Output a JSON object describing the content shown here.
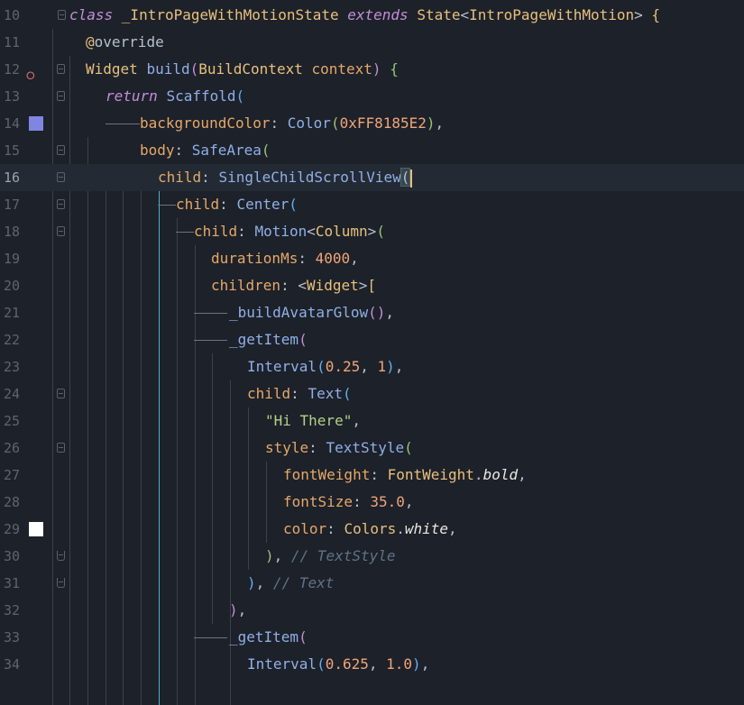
{
  "editor": {
    "language": "dart",
    "current_line": 16,
    "colors": {
      "background": "#1d2129",
      "swatch_line_14": "#8185E2",
      "swatch_line_29": "#FFFFFF"
    },
    "lines": [
      {
        "n": "10",
        "segs": [
          [
            "kw",
            "class "
          ],
          [
            "cls",
            "_IntroPageWithMotionState "
          ],
          [
            "kw",
            "extends "
          ],
          [
            "cls",
            "State"
          ],
          [
            "pun",
            "<"
          ],
          [
            "cls",
            "IntroPageWithMotion"
          ],
          [
            "pun",
            "> "
          ],
          [
            "p1",
            "{"
          ]
        ]
      },
      {
        "n": "11",
        "segs": [
          [
            "anno",
            "@"
          ],
          [
            "pun",
            "override"
          ]
        ]
      },
      {
        "n": "12",
        "segs": [
          [
            "cls",
            "Widget "
          ],
          [
            "fn",
            "build"
          ],
          [
            "p2",
            "("
          ],
          [
            "cls",
            "BuildContext "
          ],
          [
            "prop",
            "context"
          ],
          [
            "p2",
            ")"
          ],
          [
            "pun",
            " "
          ],
          [
            "p4",
            "{"
          ]
        ]
      },
      {
        "n": "13",
        "segs": [
          [
            "kw",
            "return "
          ],
          [
            "fn",
            "Scaffold"
          ],
          [
            "p3",
            "("
          ]
        ]
      },
      {
        "n": "14",
        "segs": [
          [
            "prop",
            "backgroundColor"
          ],
          [
            "pun",
            ": "
          ],
          [
            "fn",
            "Color"
          ],
          [
            "p4",
            "("
          ],
          [
            "num-lit",
            "0xFF8185E2"
          ],
          [
            "p4",
            ")"
          ],
          [
            "pun",
            ","
          ]
        ]
      },
      {
        "n": "15",
        "segs": [
          [
            "prop",
            "body"
          ],
          [
            "pun",
            ": "
          ],
          [
            "fn",
            "SafeArea"
          ],
          [
            "p4",
            "("
          ]
        ]
      },
      {
        "n": "16",
        "segs": [
          [
            "prop",
            "child"
          ],
          [
            "pun",
            ": "
          ],
          [
            "fn",
            "SingleChildScrollView"
          ],
          [
            "paren",
            "("
          ]
        ]
      },
      {
        "n": "17",
        "segs": [
          [
            "prop",
            "child"
          ],
          [
            "pun",
            ": "
          ],
          [
            "fn",
            "Center"
          ],
          [
            "p3",
            "("
          ]
        ]
      },
      {
        "n": "18",
        "segs": [
          [
            "prop",
            "child"
          ],
          [
            "pun",
            ": "
          ],
          [
            "fn",
            "Motion"
          ],
          [
            "pun",
            "<"
          ],
          [
            "cls",
            "Column"
          ],
          [
            "pun",
            ">"
          ],
          [
            "p4",
            "("
          ]
        ]
      },
      {
        "n": "19",
        "segs": [
          [
            "prop",
            "durationMs"
          ],
          [
            "pun",
            ": "
          ],
          [
            "num-lit",
            "4000"
          ],
          [
            "pun",
            ","
          ]
        ]
      },
      {
        "n": "20",
        "segs": [
          [
            "prop",
            "children"
          ],
          [
            "pun",
            ": <"
          ],
          [
            "cls",
            "Widget"
          ],
          [
            "pun",
            ">"
          ],
          [
            "p1",
            "["
          ]
        ]
      },
      {
        "n": "21",
        "segs": [
          [
            "fn",
            "_buildAvatarGlow"
          ],
          [
            "p2",
            "()"
          ],
          [
            "pun",
            ","
          ]
        ]
      },
      {
        "n": "22",
        "segs": [
          [
            "fn",
            "_getItem"
          ],
          [
            "p2",
            "("
          ]
        ]
      },
      {
        "n": "23",
        "segs": [
          [
            "fn",
            "Interval"
          ],
          [
            "p3",
            "("
          ],
          [
            "num-lit",
            "0.25"
          ],
          [
            "pun",
            ", "
          ],
          [
            "num-lit",
            "1"
          ],
          [
            "p3",
            ")"
          ],
          [
            "pun",
            ","
          ]
        ]
      },
      {
        "n": "24",
        "segs": [
          [
            "prop",
            "child"
          ],
          [
            "pun",
            ": "
          ],
          [
            "fn",
            "Text"
          ],
          [
            "p3",
            "("
          ]
        ]
      },
      {
        "n": "25",
        "segs": [
          [
            "str",
            "\"Hi There\""
          ],
          [
            "pun",
            ","
          ]
        ]
      },
      {
        "n": "26",
        "segs": [
          [
            "prop",
            "style"
          ],
          [
            "pun",
            ": "
          ],
          [
            "fn",
            "TextStyle"
          ],
          [
            "p4",
            "("
          ]
        ]
      },
      {
        "n": "27",
        "segs": [
          [
            "prop",
            "fontWeight"
          ],
          [
            "pun",
            ": "
          ],
          [
            "cls",
            "FontWeight"
          ],
          [
            "pun",
            "."
          ],
          [
            "ital",
            "bold"
          ],
          [
            "pun",
            ","
          ]
        ]
      },
      {
        "n": "28",
        "segs": [
          [
            "prop",
            "fontSize"
          ],
          [
            "pun",
            ": "
          ],
          [
            "num-lit",
            "35.0"
          ],
          [
            "pun",
            ","
          ]
        ]
      },
      {
        "n": "29",
        "segs": [
          [
            "prop",
            "color"
          ],
          [
            "pun",
            ": "
          ],
          [
            "cls",
            "Colors"
          ],
          [
            "pun",
            "."
          ],
          [
            "ital",
            "white"
          ],
          [
            "pun",
            ","
          ]
        ]
      },
      {
        "n": "30",
        "segs": [
          [
            "p4",
            ")"
          ],
          [
            "pun",
            ", "
          ],
          [
            "com",
            "// TextStyle"
          ]
        ]
      },
      {
        "n": "31",
        "segs": [
          [
            "p3",
            ")"
          ],
          [
            "pun",
            ", "
          ],
          [
            "com",
            "// Text"
          ]
        ]
      },
      {
        "n": "32",
        "segs": [
          [
            "p2",
            ")"
          ],
          [
            "pun",
            ","
          ]
        ]
      },
      {
        "n": "33",
        "segs": [
          [
            "fn",
            "_getItem"
          ],
          [
            "p2",
            "("
          ]
        ]
      },
      {
        "n": "34",
        "segs": [
          [
            "fn",
            "Interval"
          ],
          [
            "p3",
            "("
          ],
          [
            "num-lit",
            "0.625"
          ],
          [
            "pun",
            ", "
          ],
          [
            "num-lit",
            "1.0"
          ],
          [
            "p3",
            ")"
          ],
          [
            "pun",
            ","
          ]
        ]
      }
    ]
  }
}
